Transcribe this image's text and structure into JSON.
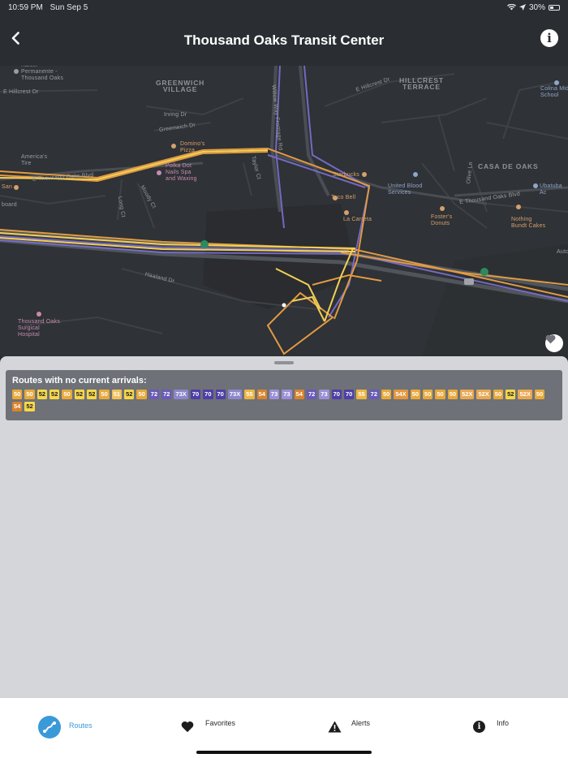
{
  "status": {
    "time": "10:59 PM",
    "date": "Sun Sep 5",
    "battery": "30%"
  },
  "header": {
    "title": "Thousand Oaks Transit Center",
    "back_icon": "chevron-left-icon",
    "info_icon": "info-icon"
  },
  "map": {
    "labels": {
      "kaiser": "Kaiser\nPermanente -\nThousand Oaks",
      "greenwich": "GREENWICH\nVILLAGE",
      "hillcrest_terrace": "HILLCREST\nTERRACE",
      "colina": "Colina Midd\nSchool",
      "e_hillcrest_left": "E Hillcrest Dr",
      "e_hillcrest_right": "E Hillcrest Dr",
      "irving": "Irving Dr",
      "greenwich_dr": "Greenwich Dr",
      "dominos": "Domino's\nPizza",
      "americas": "America's\nTire",
      "thousand_oaks_blvd_left": "E Thousand Oaks Blvd",
      "polka": "Polka Dot\nNails Spa\nand Waxing",
      "starbucks": "Starbucks",
      "taco_bell": "Taco Bell",
      "la_carreta": "La Carreta",
      "united_blood": "United Blood\nServices",
      "casa_de_oaks": "CASA DE OAKS",
      "ubatuba": "Ubatuba Ac",
      "e_thousand_oaks_right": "E Thousand Oaks Blvd",
      "fosters": "Foster's\nDonuts",
      "nothing_bundt": "Nothing\nBundt Cakes",
      "san": "San",
      "board": "board",
      "haaland": "Haaland Dr",
      "to_surgical": "Thousand Oaks\nSurgical\nHospital",
      "auto": "Auto",
      "moody": "Moody Ct",
      "long": "Long Ct",
      "taylor": "Taylor Ct",
      "wilbur": "Willow Way Frontage Rd",
      "olive": "Olive Ln"
    },
    "favorite_icon": "heart-icon"
  },
  "sheet": {
    "title": "Routes with no current arrivals:",
    "routes": [
      {
        "label": "50",
        "bg": "#e8a93a",
        "fg": "#ffffff"
      },
      {
        "label": "50",
        "bg": "#e8a93a",
        "fg": "#ffffff"
      },
      {
        "label": "52",
        "bg": "#f6d74a",
        "fg": "#1b1b1b"
      },
      {
        "label": "52",
        "bg": "#f6d74a",
        "fg": "#1b1b1b"
      },
      {
        "label": "50",
        "bg": "#e8a93a",
        "fg": "#ffffff"
      },
      {
        "label": "52",
        "bg": "#f6d74a",
        "fg": "#1b1b1b"
      },
      {
        "label": "52",
        "bg": "#f6d74a",
        "fg": "#1b1b1b"
      },
      {
        "label": "50",
        "bg": "#e8a93a",
        "fg": "#ffffff"
      },
      {
        "label": "51",
        "bg": "#f2c15a",
        "fg": "#ffffff"
      },
      {
        "label": "52",
        "bg": "#f6d74a",
        "fg": "#1b1b1b"
      },
      {
        "label": "50",
        "bg": "#e8a93a",
        "fg": "#ffffff"
      },
      {
        "label": "72",
        "bg": "#6a5ab8",
        "fg": "#ffffff"
      },
      {
        "label": "72",
        "bg": "#6a5ab8",
        "fg": "#ffffff"
      },
      {
        "label": "73X",
        "bg": "#8d86cc",
        "fg": "#ffffff"
      },
      {
        "label": "70",
        "bg": "#4e3fa6",
        "fg": "#ffffff"
      },
      {
        "label": "70",
        "bg": "#4e3fa6",
        "fg": "#ffffff"
      },
      {
        "label": "70",
        "bg": "#4e3fa6",
        "fg": "#ffffff"
      },
      {
        "label": "73X",
        "bg": "#8d86cc",
        "fg": "#ffffff"
      },
      {
        "label": "55",
        "bg": "#ecb645",
        "fg": "#ffffff"
      },
      {
        "label": "54",
        "bg": "#d9842d",
        "fg": "#ffffff"
      },
      {
        "label": "73",
        "bg": "#9b8fd6",
        "fg": "#ffffff"
      },
      {
        "label": "73",
        "bg": "#9b8fd6",
        "fg": "#ffffff"
      },
      {
        "label": "54",
        "bg": "#d9842d",
        "fg": "#ffffff"
      },
      {
        "label": "72",
        "bg": "#6a5ab8",
        "fg": "#ffffff"
      },
      {
        "label": "73",
        "bg": "#9b8fd6",
        "fg": "#ffffff"
      },
      {
        "label": "70",
        "bg": "#4e3fa6",
        "fg": "#ffffff"
      },
      {
        "label": "70",
        "bg": "#4e3fa6",
        "fg": "#ffffff"
      },
      {
        "label": "55",
        "bg": "#ecb645",
        "fg": "#ffffff"
      },
      {
        "label": "72",
        "bg": "#6a5ab8",
        "fg": "#ffffff"
      },
      {
        "label": "50",
        "bg": "#e8a93a",
        "fg": "#ffffff"
      },
      {
        "label": "54X",
        "bg": "#e3973c",
        "fg": "#ffffff"
      },
      {
        "label": "50",
        "bg": "#e8a93a",
        "fg": "#ffffff"
      },
      {
        "label": "50",
        "bg": "#e8a93a",
        "fg": "#ffffff"
      },
      {
        "label": "50",
        "bg": "#e8a93a",
        "fg": "#ffffff"
      },
      {
        "label": "50",
        "bg": "#e8a93a",
        "fg": "#ffffff"
      },
      {
        "label": "52X",
        "bg": "#e9a851",
        "fg": "#ffffff"
      },
      {
        "label": "52X",
        "bg": "#e9a851",
        "fg": "#ffffff"
      },
      {
        "label": "50",
        "bg": "#e8a93a",
        "fg": "#ffffff"
      },
      {
        "label": "52",
        "bg": "#f6d74a",
        "fg": "#1b1b1b"
      },
      {
        "label": "52X",
        "bg": "#e9a851",
        "fg": "#ffffff"
      },
      {
        "label": "50",
        "bg": "#e8a93a",
        "fg": "#ffffff"
      },
      {
        "label": "54",
        "bg": "#d9842d",
        "fg": "#ffffff"
      },
      {
        "label": "52",
        "bg": "#f6d74a",
        "fg": "#1b1b1b"
      }
    ]
  },
  "tabs": {
    "routes": "Routes",
    "favorites": "Favorites",
    "alerts": "Alerts",
    "info": "Info"
  },
  "colors": {
    "accent": "#3a9ad9",
    "header_bg": "#2a2e33",
    "sheet_bg": "#d5d6da",
    "card_bg": "#6e7177"
  }
}
